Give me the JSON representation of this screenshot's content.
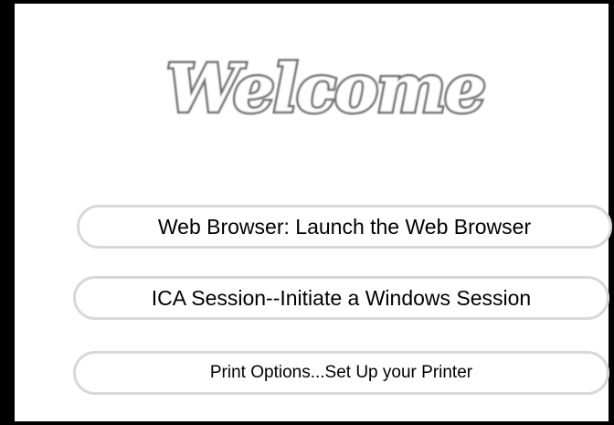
{
  "welcome": {
    "title": "Welcome"
  },
  "menu": {
    "items": [
      {
        "label": "Web Browser: Launch the Web Browser"
      },
      {
        "label": "ICA Session--Initiate a Windows Session"
      },
      {
        "label": "Print Options...Set Up your Printer"
      }
    ]
  },
  "colors": {
    "frame": "#000000",
    "button_border": "#d8d8d8",
    "welcome_outline": "#6e6e6e",
    "background": "#ffffff"
  }
}
